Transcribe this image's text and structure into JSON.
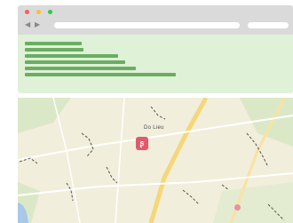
{
  "browser": {
    "window_controls": [
      "close",
      "minimize",
      "maximize"
    ],
    "nav_back_icon": "◀",
    "nav_forward_icon": "▶",
    "address_value": "",
    "search_value": ""
  },
  "content": {
    "placeholder_lines": 6
  },
  "map": {
    "place_label": "Do   Lieu",
    "pin_glyph": "ʂ",
    "colors": {
      "land": "#f1eedb",
      "park": "#d9e8c6",
      "road_major": "#f5d77a",
      "pin": "#e2586c",
      "water": "#a8c8e8"
    }
  },
  "colors": {
    "chrome": "#dadada",
    "content_bg": "#dff1d7",
    "placeholder_bar": "#6aad63"
  }
}
